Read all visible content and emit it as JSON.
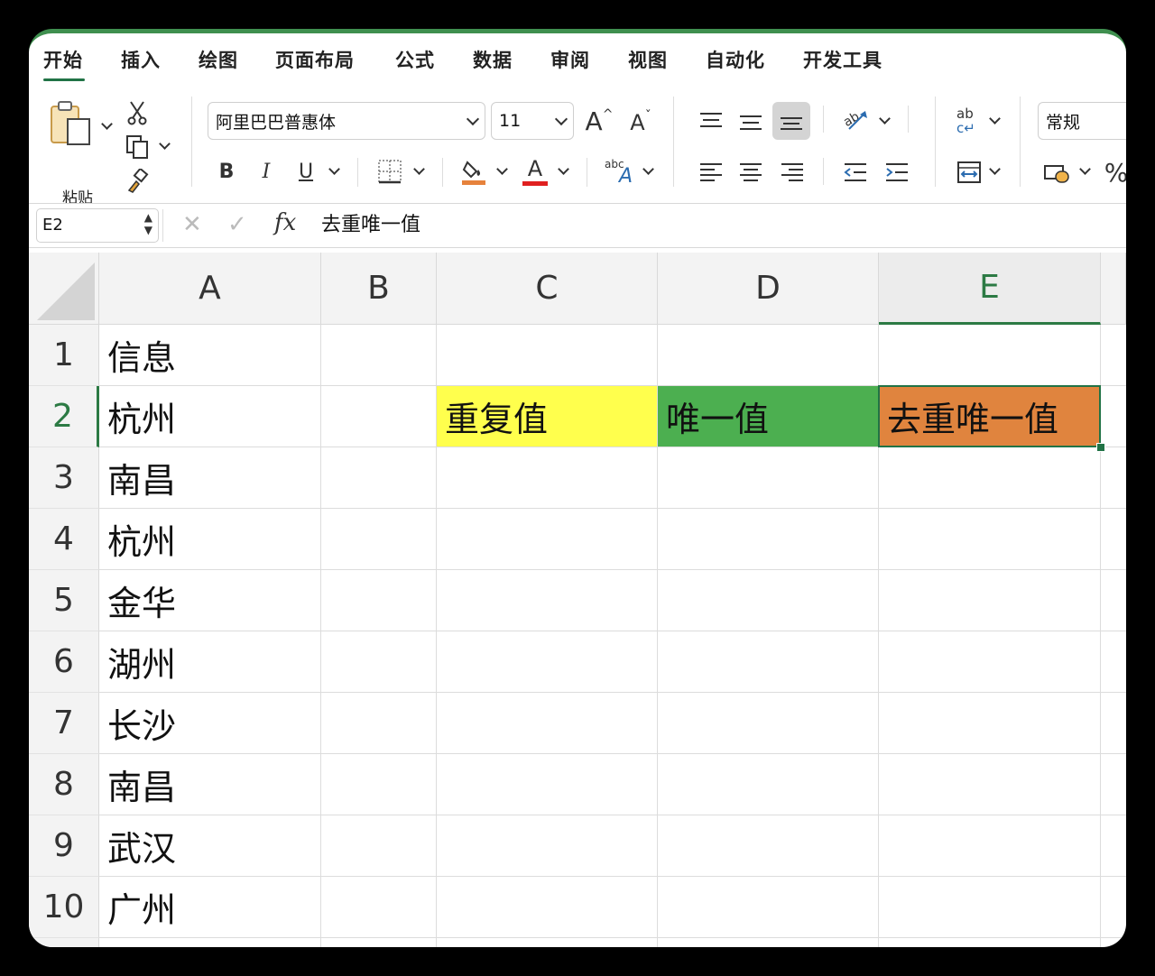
{
  "ribbon": {
    "tabs": [
      "开始",
      "插入",
      "绘图",
      "页面布局",
      "公式",
      "数据",
      "审阅",
      "视图",
      "自动化",
      "开发工具"
    ],
    "active_tab": "开始"
  },
  "toolbar": {
    "paste_label": "粘贴",
    "font_name": "阿里巴巴普惠体",
    "font_size": "11",
    "bold": "B",
    "italic": "I",
    "underline": "U",
    "grow_font": "A",
    "shrink_font": "A",
    "font_color_letter": "A",
    "number_format": "常规",
    "percent": "%",
    "abc_label": "abc",
    "wrap_label": "ab",
    "fill_color": "#e6823c",
    "font_color": "#e02020"
  },
  "formula_bar": {
    "name_box": "E2",
    "fx": "fx",
    "cancel": "✕",
    "confirm": "✓",
    "content": "去重唯一值"
  },
  "sheet": {
    "columns": [
      "A",
      "B",
      "C",
      "D",
      "E"
    ],
    "selected_column": "E",
    "rows": [
      {
        "num": "1",
        "A": "信息",
        "B": "",
        "C": "",
        "D": "",
        "E": ""
      },
      {
        "num": "2",
        "A": "杭州",
        "B": "",
        "C": "重复值",
        "D": "唯一值",
        "E": "去重唯一值"
      },
      {
        "num": "3",
        "A": "南昌",
        "B": "",
        "C": "",
        "D": "",
        "E": ""
      },
      {
        "num": "4",
        "A": "杭州",
        "B": "",
        "C": "",
        "D": "",
        "E": ""
      },
      {
        "num": "5",
        "A": "金华",
        "B": "",
        "C": "",
        "D": "",
        "E": ""
      },
      {
        "num": "6",
        "A": "湖州",
        "B": "",
        "C": "",
        "D": "",
        "E": ""
      },
      {
        "num": "7",
        "A": "长沙",
        "B": "",
        "C": "",
        "D": "",
        "E": ""
      },
      {
        "num": "8",
        "A": "南昌",
        "B": "",
        "C": "",
        "D": "",
        "E": ""
      },
      {
        "num": "9",
        "A": "武汉",
        "B": "",
        "C": "",
        "D": "",
        "E": ""
      },
      {
        "num": "10",
        "A": "广州",
        "B": "",
        "C": "",
        "D": "",
        "E": ""
      }
    ],
    "cell_colors": {
      "C2": "#ffff4d",
      "D2": "#4caf50",
      "E2": "#e0843e"
    },
    "selected_cell": "E2",
    "selected_row": "2"
  }
}
